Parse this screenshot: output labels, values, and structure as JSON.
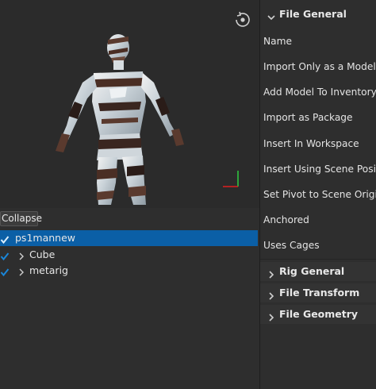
{
  "tree": {
    "collapse_label": "Collapse",
    "items": [
      {
        "label": "ps1mannew",
        "checked": true,
        "selected": true
      },
      {
        "label": "Cube",
        "checked": true,
        "selected": false
      },
      {
        "label": "metarig",
        "checked": true,
        "selected": false
      }
    ]
  },
  "panel": {
    "file_general_label": "File General",
    "properties": [
      "Name",
      "Import Only as a Model",
      "Add Model To Inventory",
      "Import as Package",
      "Insert In Workspace",
      "Insert Using Scene Position",
      "Set Pivot to Scene Origin",
      "Anchored",
      "Uses Cages"
    ],
    "sections": [
      "Rig General",
      "File Transform",
      "File Geometry"
    ]
  },
  "colors": {
    "selection": "#0b5fa6",
    "checkbox": "#1a86d8",
    "axis_y": "#2ecc40",
    "axis_x": "#e02020"
  }
}
